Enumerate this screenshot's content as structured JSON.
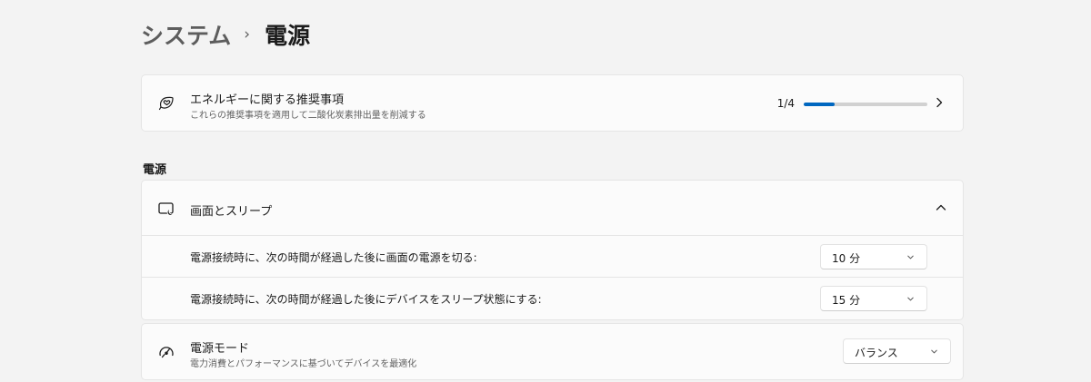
{
  "breadcrumb": {
    "parent": "システム",
    "separator": "›",
    "current": "電源"
  },
  "recommendations": {
    "icon": "leaf-heart-icon",
    "title": "エネルギーに関する推奨事項",
    "subtitle": "これらの推奨事項を適用して二酸化炭素排出量を削減する",
    "progress_text": "1/4",
    "progress_fraction": 0.25,
    "accent_color": "#0067c0"
  },
  "power_section": {
    "label": "電源",
    "screen_sleep": {
      "icon": "screen-sleep-icon",
      "title": "画面とスリープ",
      "expanded": true,
      "rows": [
        {
          "label": "電源接続時に、次の時間が経過した後に画面の電源を切る:",
          "value": "10 分"
        },
        {
          "label": "電源接続時に、次の時間が経過した後にデバイスをスリープ状態にする:",
          "value": "15 分"
        }
      ]
    },
    "power_mode": {
      "icon": "gauge-icon",
      "title": "電源モード",
      "subtitle": "電力消費とパフォーマンスに基づいてデバイスを最適化",
      "value": "バランス"
    }
  }
}
